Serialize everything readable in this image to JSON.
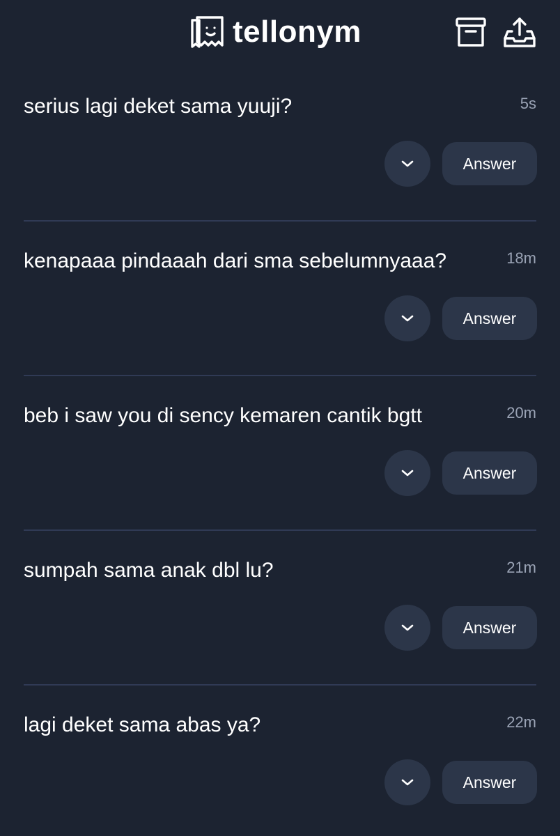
{
  "header": {
    "brand_name": "tellonym",
    "brand_logo_icon": "tellonym-logo-icon",
    "archive_icon": "archive-box-icon",
    "share_icon": "share-upload-icon"
  },
  "colors": {
    "background": "#1c2331",
    "button_background": "#2c3649",
    "divider": "#303a55",
    "time_text": "#9aa3b5"
  },
  "feed": {
    "items": [
      {
        "question": "serius lagi deket sama yuuji?",
        "time": "5s",
        "answer_label": "Answer",
        "expand_icon": "chevron-down-icon"
      },
      {
        "question": "kenapaaa pindaaah dari sma sebelumnyaaa?",
        "time": "18m",
        "answer_label": "Answer",
        "expand_icon": "chevron-down-icon"
      },
      {
        "question": "beb i saw you di sency kemaren cantik bgtt",
        "time": "20m",
        "answer_label": "Answer",
        "expand_icon": "chevron-down-icon"
      },
      {
        "question": "sumpah sama anak dbl lu?",
        "time": "21m",
        "answer_label": "Answer",
        "expand_icon": "chevron-down-icon"
      },
      {
        "question": "lagi deket sama abas ya?",
        "time": "22m",
        "answer_label": "Answer",
        "expand_icon": "chevron-down-icon"
      }
    ]
  }
}
